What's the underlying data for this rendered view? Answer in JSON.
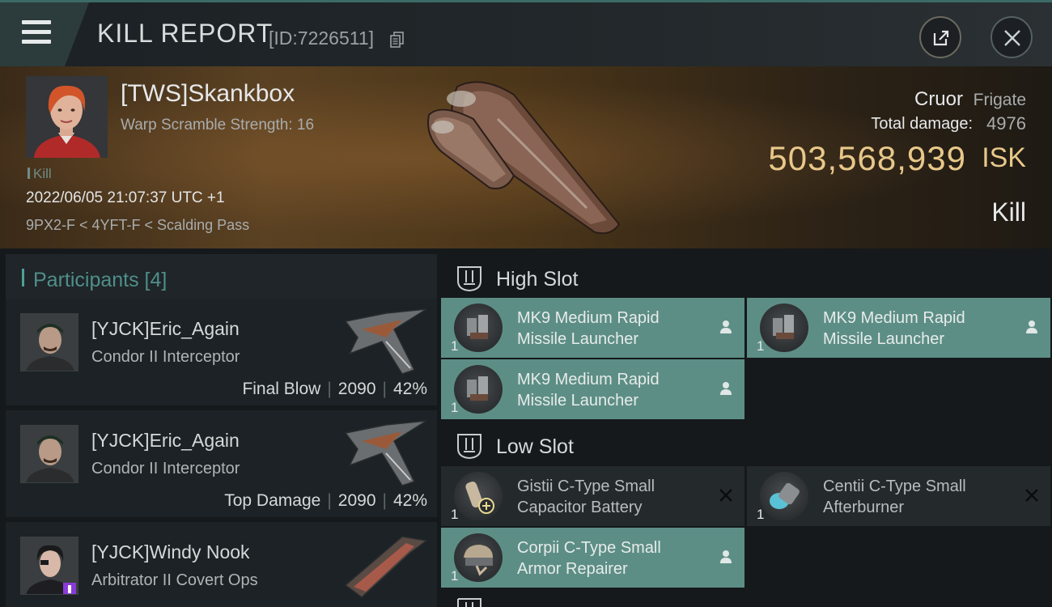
{
  "header": {
    "title": "KILL REPORT",
    "id_label": "[ID:7226511]"
  },
  "victim": {
    "name": "[TWS]Skankbox",
    "warp_scramble": "Warp Scramble Strength: 16",
    "tag": "Kill",
    "datetime": "2022/06/05 21:07:37 UTC +1",
    "location": "9PX2-F < 4YFT-F < Scalding Pass"
  },
  "summary": {
    "ship_name": "Cruor",
    "ship_class": "Frigate",
    "damage_label": "Total damage:",
    "damage_value": "4976",
    "isk_value": "503,568,939",
    "isk_unit": "ISK",
    "status": "Kill"
  },
  "participants": {
    "title": "Participants [4]",
    "items": [
      {
        "name": "[YJCK]Eric_Again",
        "ship": "Condor II Interceptor",
        "role": "Final Blow",
        "damage": "2090",
        "percent": "42%"
      },
      {
        "name": "[YJCK]Eric_Again",
        "ship": "Condor II Interceptor",
        "role": "Top Damage",
        "damage": "2090",
        "percent": "42%"
      },
      {
        "name": "[YJCK]Windy Nook",
        "ship": "Arbitrator II Covert Ops"
      }
    ]
  },
  "fitting": {
    "high_slot": {
      "title": "High Slot",
      "modules": [
        {
          "qty": "1",
          "name_line1": "MK9 Medium Rapid",
          "name_line2": "Missile Launcher",
          "status": "person-icon"
        },
        {
          "qty": "1",
          "name_line1": "MK9 Medium Rapid",
          "name_line2": "Missile Launcher",
          "status": "person-icon"
        },
        {
          "qty": "1",
          "name_line1": "MK9 Medium Rapid",
          "name_line2": "Missile Launcher",
          "status": "person-icon"
        }
      ]
    },
    "low_slot": {
      "title": "Low Slot",
      "modules": [
        {
          "qty": "1",
          "name_line1": "Gistii C-Type Small",
          "name_line2": "Capacitor Battery",
          "status": "destroyed-x-icon"
        },
        {
          "qty": "1",
          "name_line1": "Centii C-Type Small",
          "name_line2": "Afterburner",
          "status": "destroyed-x-icon"
        },
        {
          "qty": "1",
          "name_line1": "Corpii C-Type Small",
          "name_line2": "Armor Repairer",
          "status": "person-icon"
        }
      ]
    }
  },
  "colors": {
    "accent_teal": "#5d8e86",
    "isk_gold": "#e8c88a",
    "header_teal": "#3c6a66"
  }
}
